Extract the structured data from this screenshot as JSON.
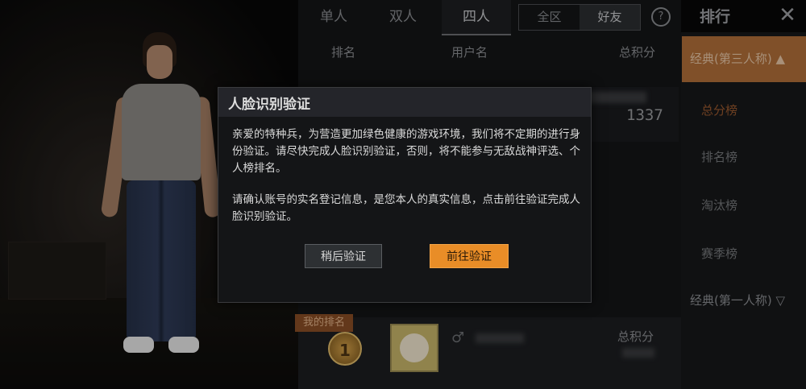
{
  "modes": {
    "solo": "单人",
    "duo": "双人",
    "squad": "四人"
  },
  "region": {
    "all": "全区",
    "friends": "好友"
  },
  "help_icon": "?",
  "rank_title": "排行",
  "close_icon": "✕",
  "columns": {
    "rank": "排名",
    "username": "用户名",
    "total_score": "总积分"
  },
  "first_row_score": "1337",
  "side_menu": {
    "category_active": "经典(第三人称) ▲",
    "items": [
      "总分榜",
      "排名榜",
      "淘汰榜",
      "赛季榜"
    ],
    "category_other": "经典(第一人称) ▽"
  },
  "my_rank": {
    "tag": "我的排名",
    "medal": "1",
    "gender_icon": "♂",
    "score_label": "总积分"
  },
  "dialog": {
    "title": "人脸识别验证",
    "paragraph1": "亲爱的特种兵，为营造更加绿色健康的游戏环境，我们将不定期的进行身份验证。请尽快完成人脸识别验证，否则，将不能参与无敌战神评选、个人榜排名。",
    "paragraph2": "请确认账号的实名登记信息，是您本人的真实信息，点击前往验证完成人脸识别验证。",
    "later_button": "稍后验证",
    "go_button": "前往验证"
  },
  "colors": {
    "accent_orange": "#e98d27",
    "side_active": "#b2703a"
  }
}
